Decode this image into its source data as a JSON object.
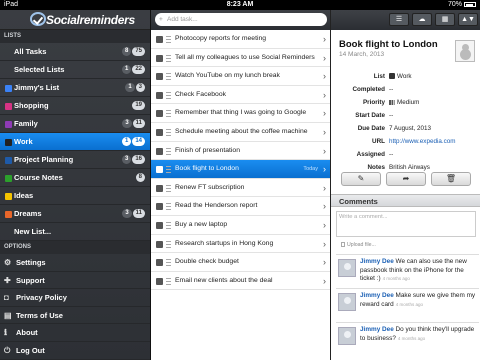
{
  "status_bar": {
    "device": "iPad",
    "time": "8:23 AM",
    "battery": "70%"
  },
  "app": {
    "name": "Socialreminders"
  },
  "sidebar": {
    "lists_header": "LISTS",
    "lists": [
      {
        "label": "All Tasks",
        "badges": [
          "8",
          "75"
        ],
        "color": ""
      },
      {
        "label": "Selected Lists",
        "badges": [
          "1",
          "22"
        ],
        "color": ""
      },
      {
        "label": "Jimmy's List",
        "badges": [
          "1",
          "3"
        ],
        "color": "#3b82f6"
      },
      {
        "label": "Shopping",
        "badges": [
          "19"
        ],
        "color": "#d63384"
      },
      {
        "label": "Family",
        "badges": [
          "3",
          "11"
        ],
        "color": "#8e3bb5"
      },
      {
        "label": "Work",
        "badges": [
          "1",
          "14"
        ],
        "color": "#222222"
      },
      {
        "label": "Project Planning",
        "badges": [
          "3",
          "16"
        ],
        "color": "#1e5aa8"
      },
      {
        "label": "Course Notes",
        "badges": [
          "8"
        ],
        "color": "#2ca02c"
      },
      {
        "label": "Ideas",
        "badges": [],
        "color": "#f5c400"
      },
      {
        "label": "Dreams",
        "badges": [
          "3",
          "11"
        ],
        "color": "#e8662a"
      },
      {
        "label": "New List...",
        "badges": [],
        "color": ""
      }
    ],
    "options_header": "OPTIONS",
    "options": [
      {
        "label": "Settings",
        "icon": "gear-icon",
        "glyph": "⚙"
      },
      {
        "label": "Support",
        "icon": "support-icon",
        "glyph": "✚"
      },
      {
        "label": "Privacy Policy",
        "icon": "lock-icon",
        "glyph": "◘"
      },
      {
        "label": "Terms of Use",
        "icon": "document-icon",
        "glyph": "▤"
      },
      {
        "label": "About",
        "icon": "info-icon",
        "glyph": "ℹ"
      },
      {
        "label": "Log Out",
        "icon": "power-icon",
        "glyph": "⏻"
      }
    ]
  },
  "tasks": {
    "add_placeholder": "Add task...",
    "items": [
      {
        "title": "Photocopy reports for meeting",
        "selected": false
      },
      {
        "title": "Tell all my colleagues to use Social Reminders",
        "selected": false
      },
      {
        "title": "Watch YouTube on my lunch break",
        "selected": false
      },
      {
        "title": "Check Facebook",
        "selected": false
      },
      {
        "title": "Remember that thing I was going to Google",
        "selected": false
      },
      {
        "title": "Schedule meeting about the coffee machine",
        "selected": false
      },
      {
        "title": "Finish of presentation",
        "selected": false
      },
      {
        "title": "Book flight to London",
        "selected": true,
        "tag": "Today"
      },
      {
        "title": "Renew FT subscription",
        "selected": false
      },
      {
        "title": "Read the Henderson report",
        "selected": false
      },
      {
        "title": "Buy a new laptop",
        "selected": false
      },
      {
        "title": "Research startups in Hong Kong",
        "selected": false
      },
      {
        "title": "Double check budget",
        "selected": false
      },
      {
        "title": "Email new clients about the deal",
        "selected": false
      }
    ]
  },
  "toolbar": {
    "list_view": "☰",
    "cloud": "☁",
    "grid": "▦",
    "sort": "▲▼"
  },
  "detail": {
    "title": "Book flight to London",
    "date": "14 March, 2013",
    "fields": [
      {
        "key": "List",
        "value": "Work",
        "kind": "list"
      },
      {
        "key": "Completed",
        "value": "--",
        "kind": "text"
      },
      {
        "key": "Priority",
        "value": "Medium",
        "kind": "priority"
      },
      {
        "key": "Start Date",
        "value": "--",
        "kind": "text"
      },
      {
        "key": "Due Date",
        "value": "7 August, 2013",
        "kind": "text"
      },
      {
        "key": "URL",
        "value": "http://www.expedia.com",
        "kind": "link"
      },
      {
        "key": "Assigned",
        "value": "--",
        "kind": "text"
      },
      {
        "key": "Notes",
        "value": "British Airways",
        "kind": "text"
      }
    ],
    "actions": {
      "edit": "✎",
      "share": "➦",
      "delete": "🗑"
    }
  },
  "comments": {
    "header": "Comments",
    "input_placeholder": "Write a comment...",
    "upload_label": "Upload file...",
    "items": [
      {
        "name": "Jimmy Dee",
        "text": "We can also use the new passbook think on the iPhone for the ticket :)",
        "time": "4 months ago"
      },
      {
        "name": "Jimmy Dee",
        "text": "Make sure we give them my reward card",
        "time": "4 months ago"
      },
      {
        "name": "Jimmy Dee",
        "text": "Do you think they'll upgrade to business?",
        "time": "4 months ago"
      }
    ]
  }
}
